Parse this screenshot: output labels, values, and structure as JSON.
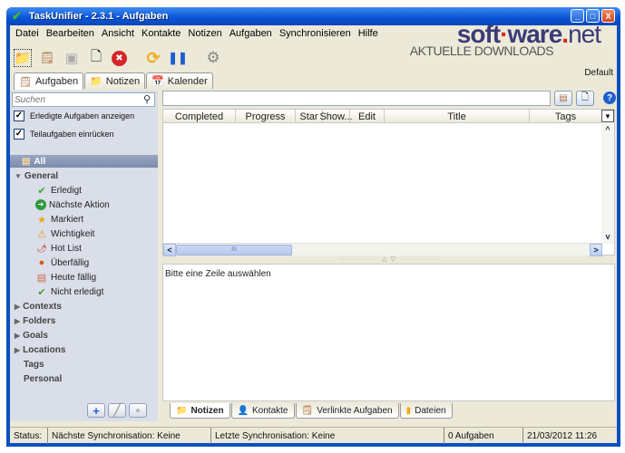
{
  "window": {
    "title": "TaskUnifier - 2.3.1 - Aufgaben",
    "controls": {
      "minimize": "_",
      "maximize": "□",
      "close": "X"
    }
  },
  "menu": [
    "Datei",
    "Bearbeiten",
    "Ansicht",
    "Kontakte",
    "Notizen",
    "Aufgaben",
    "Synchronisieren",
    "Hilfe"
  ],
  "brand": {
    "name_a": "soft",
    "name_b": "ware",
    "name_c": "net",
    "tagline": "AKTUELLE DOWNLOADS",
    "profile": "Default"
  },
  "toolbar": [
    {
      "name": "new-note-icon",
      "glyph": "📁"
    },
    {
      "name": "new-task-icon",
      "glyph": "🗒"
    },
    {
      "name": "copy-icon",
      "glyph": "▣"
    },
    {
      "name": "edit-icon",
      "glyph": "🗋"
    },
    {
      "name": "delete-icon",
      "glyph": "✖"
    },
    {
      "name": "sync-icon",
      "glyph": "⟳"
    },
    {
      "name": "pause-icon",
      "glyph": "❚❚"
    },
    {
      "name": "settings-icon",
      "glyph": "⚙"
    }
  ],
  "tabs": [
    {
      "label": "Aufgaben",
      "icon": "🗒",
      "active": true
    },
    {
      "label": "Notizen",
      "icon": "📁",
      "active": false
    },
    {
      "label": "Kalender",
      "icon": "📅",
      "active": false
    }
  ],
  "sidebar": {
    "search_placeholder": "Suchen",
    "show_completed": {
      "label": "Erledigte Aufgaben anzeigen",
      "checked": true
    },
    "indent_subtasks": {
      "label": "Teilaufgaben einrücken",
      "checked": true
    },
    "all_label": "All",
    "general": {
      "label": "General",
      "items": [
        {
          "label": "Erledigt",
          "icon": "✔",
          "color": "#3aa52a"
        },
        {
          "label": "Nächste Aktion",
          "icon": "➜",
          "color": "#2f9a3a"
        },
        {
          "label": "Markiert",
          "icon": "★",
          "color": "#f0a410"
        },
        {
          "label": "Wichtigkeit",
          "icon": "⚠",
          "color": "#e49b12"
        },
        {
          "label": "Hot List",
          "icon": "🌶",
          "color": "#c0281c"
        },
        {
          "label": "Überfällig",
          "icon": "●",
          "color": "#e05a14"
        },
        {
          "label": "Heute fällig",
          "icon": "▤",
          "color": "#d06a50"
        },
        {
          "label": "Nicht erledigt",
          "icon": "✔",
          "color": "#3aa52a"
        }
      ]
    },
    "groups": [
      "Contexts",
      "Folders",
      "Goals",
      "Locations"
    ],
    "leaves": [
      "Tags",
      "Personal"
    ],
    "buttons": {
      "add": "+",
      "edit": "╱",
      "remove": "●"
    }
  },
  "table": {
    "columns": [
      "Completed",
      "Progress",
      "Star",
      "Show...",
      "Edit",
      "Title",
      "Tags"
    ],
    "rows": []
  },
  "detail": {
    "placeholder": "Bitte eine Zeile auswählen"
  },
  "bottom_tabs": [
    {
      "label": "Notizen",
      "icon": "📁",
      "active": true
    },
    {
      "label": "Kontakte",
      "icon": "👤",
      "active": false
    },
    {
      "label": "Verlinkte Aufgaben",
      "icon": "🗒",
      "active": false
    },
    {
      "label": "Dateien",
      "icon": "▮",
      "active": false
    }
  ],
  "status": {
    "label": "Status:",
    "next_sync": "Nächste Synchronisation: Keine",
    "last_sync": "Letzte Synchronisation: Keine",
    "count": "0 Aufgaben",
    "datetime": "21/03/2012 11:26"
  }
}
